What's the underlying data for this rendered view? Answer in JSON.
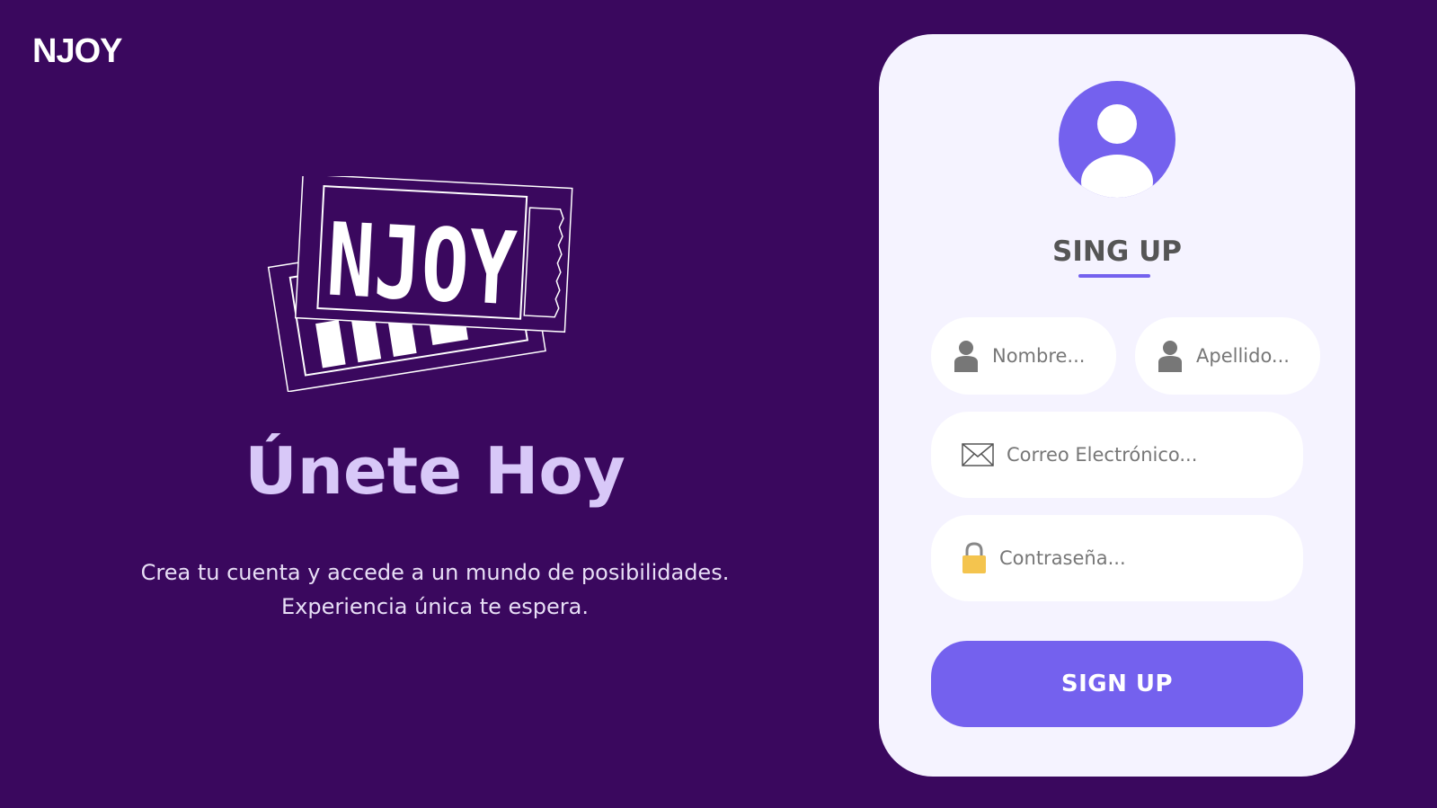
{
  "brand": {
    "name": "NJOY"
  },
  "hero": {
    "logo_text": "NJOY",
    "title": "Únete Hoy",
    "subtitle_lines": [
      "Crea tu cuenta y accede a un mundo de posibilidades.",
      "Experiencia única te espera."
    ]
  },
  "form": {
    "title": "SING UP",
    "fields": {
      "nombre": {
        "placeholder": "Nombre...",
        "icon": "user-icon",
        "value": ""
      },
      "apellido": {
        "placeholder": "Apellido...",
        "icon": "user-icon",
        "value": ""
      },
      "email": {
        "placeholder": "Correo Electrónico...",
        "icon": "envelope-icon",
        "value": ""
      },
      "password": {
        "placeholder": "Contraseña...",
        "icon": "lock-icon",
        "value": ""
      }
    },
    "submit_label": "SIGN UP",
    "avatar_icon": "user-avatar-icon"
  },
  "colors": {
    "background": "#3a085e",
    "card": "#f5f3ff",
    "accent": "#7461ee",
    "hero_title": "#d8c8f8",
    "lock": "#f4c44e"
  }
}
